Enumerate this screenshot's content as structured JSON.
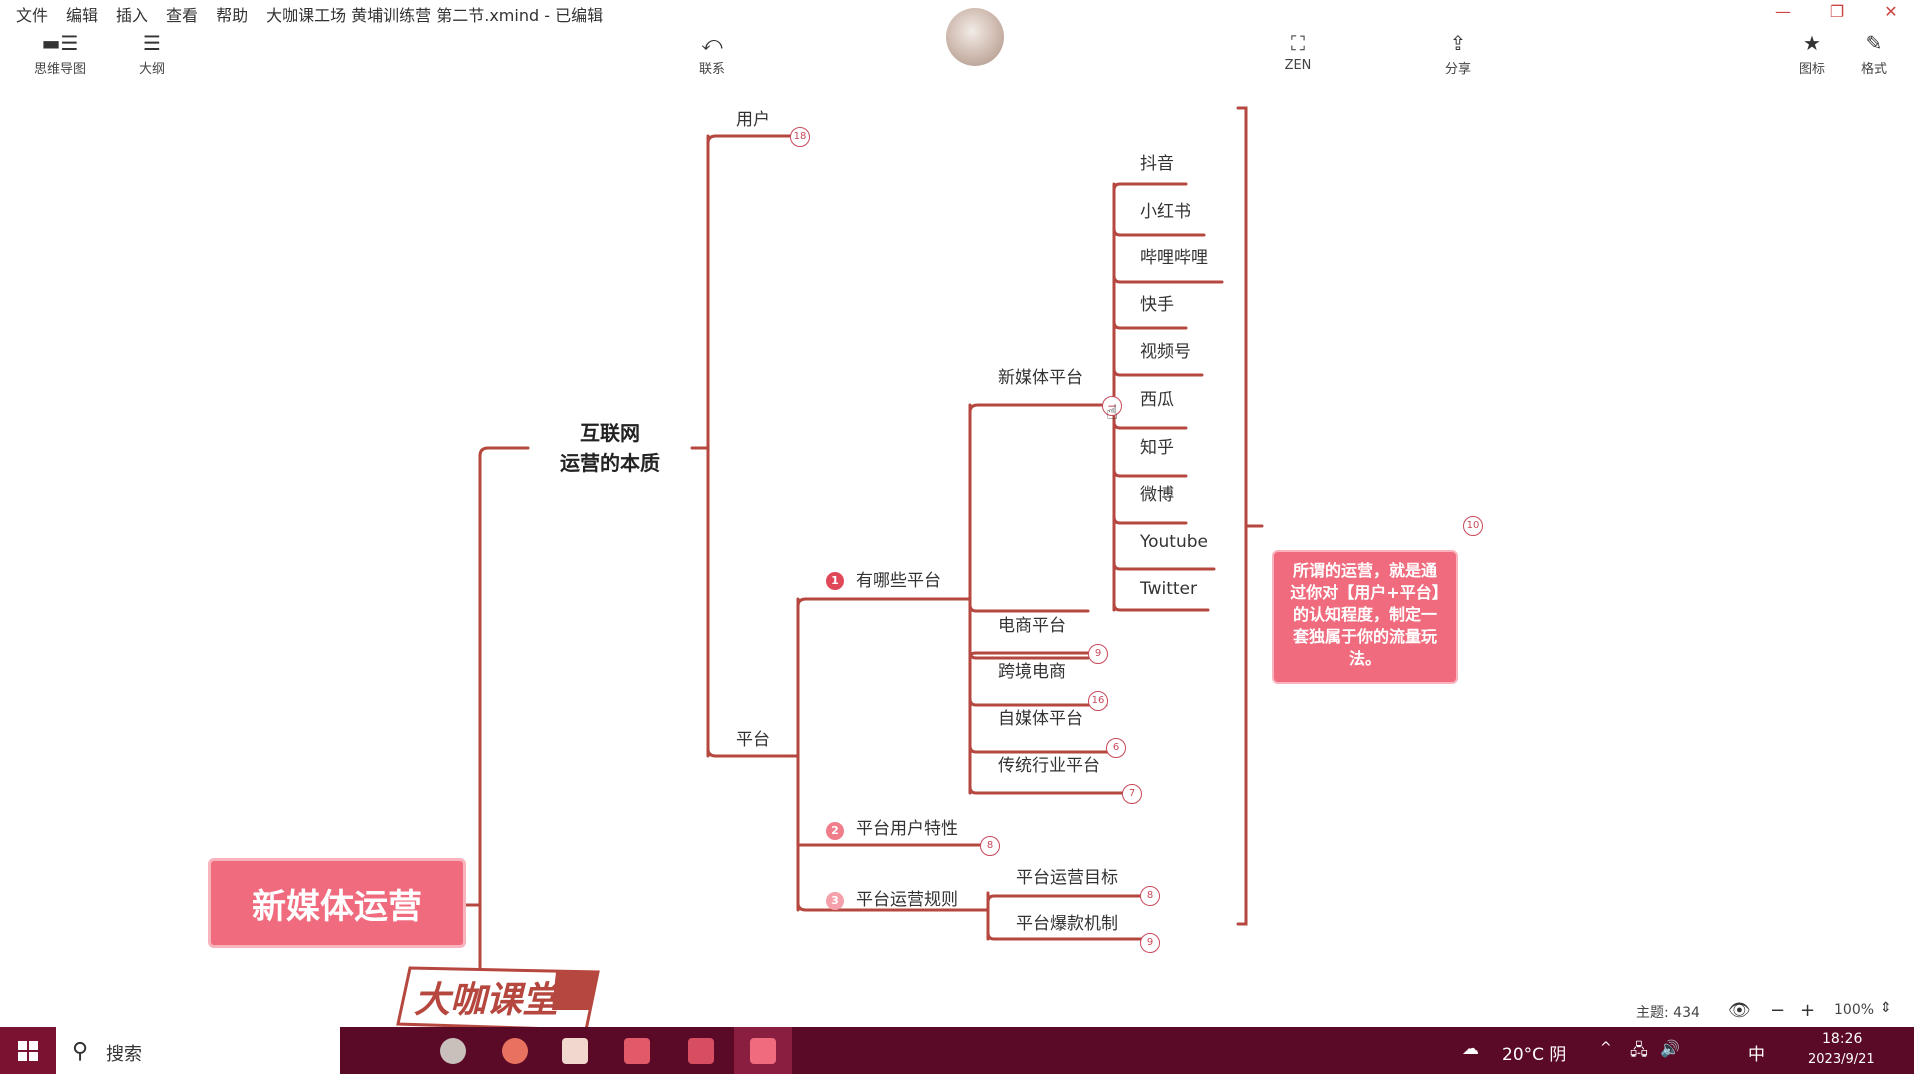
{
  "menu": [
    "文件",
    "编辑",
    "插入",
    "查看",
    "帮助"
  ],
  "document": {
    "title": "大咖课工场 黄埔训练营 第二节.xmind - 已编辑"
  },
  "toolbar": {
    "outline_label": "大纲",
    "mindmap_label": "思维导图",
    "relationship_label": "联系",
    "zen_label": "ZEN",
    "share_label": "分享",
    "icon_label": "图标",
    "format_label": "格式"
  },
  "mindmap": {
    "central": "新媒体运营",
    "main_topic_line1": "互联网",
    "main_topic_line2": "运营的本质",
    "users": {
      "label": "用户",
      "collapsed_count": "18"
    },
    "platform": {
      "label": "平台",
      "which": {
        "label": "有哪些平台",
        "number": "1",
        "new_media": {
          "label": "新媒体平台",
          "items": [
            "抖音",
            "小红书",
            "哔哩哔哩",
            "快手",
            "视频号",
            "西瓜",
            "知乎",
            "微博",
            "Youtube",
            "Twitter"
          ]
        },
        "ecommerce": {
          "label": "电商平台",
          "count": "9"
        },
        "cross_border": {
          "label": "跨境电商",
          "count": "16"
        },
        "self_media": {
          "label": "自媒体平台",
          "count": "6"
        },
        "traditional": {
          "label": "传统行业平台",
          "count": "7"
        }
      },
      "user_traits": {
        "label": "平台用户特性",
        "number": "2",
        "count": "8"
      },
      "rules": {
        "label": "平台运营规则",
        "number": "3",
        "goal": {
          "label": "平台运营目标",
          "count": "8"
        },
        "viral": {
          "label": "平台爆款机制",
          "count": "9"
        }
      }
    },
    "summary": {
      "text": "所谓的运营，就是通过你对【用户+平台】的认知程度，制定一套独属于你的流量玩法。",
      "count": "10"
    }
  },
  "watermark": "大咖课堂",
  "status": {
    "topic_count": "主题: 434",
    "zoom": "100%"
  },
  "taskbar": {
    "search_label": "搜索",
    "weather": "20°C 阴",
    "ime": "中",
    "time": "18:26",
    "date": "2023/9/21"
  },
  "colors": {
    "branch": "#b5473f",
    "accent": "#f06b7d",
    "taskbar": "#5a0a26"
  }
}
